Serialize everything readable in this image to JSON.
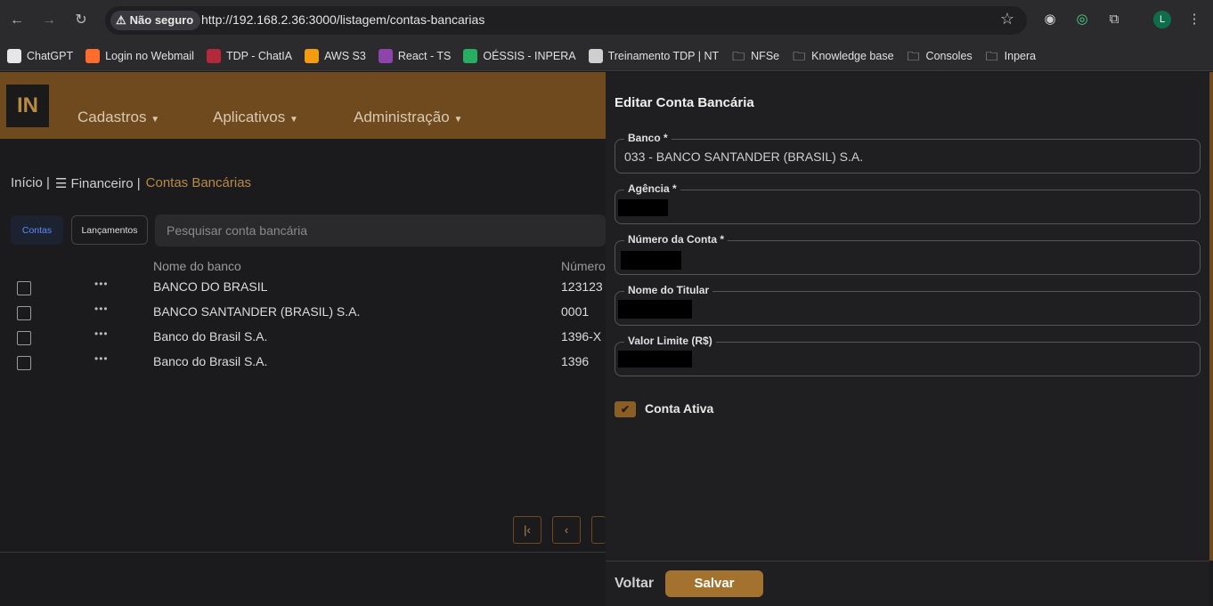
{
  "browser": {
    "security_label": "Não seguro",
    "url": "http://192.168.2.36:3000/listagem/contas-bancarias",
    "profile_initial": "L",
    "bookmarks": [
      {
        "label": "ChatGPT",
        "color": "#e6e6e6"
      },
      {
        "label": "Login no Webmail",
        "color": "#ff6c2c"
      },
      {
        "label": "TDP - ChatIA",
        "color": "#b3293a"
      },
      {
        "label": "AWS S3",
        "color": "#f39c12"
      },
      {
        "label": "React - TS",
        "color": "#8e44ad"
      },
      {
        "label": "OÉSSIS - INPERA",
        "color": "#27ae60"
      },
      {
        "label": "Treinamento TDP | NT",
        "color": "#cfcfcf"
      },
      {
        "label": "NFSe",
        "color": "folder"
      },
      {
        "label": "Knowledge base",
        "color": "folder"
      },
      {
        "label": "Consoles",
        "color": "folder"
      },
      {
        "label": "Inpera",
        "color": "folder"
      }
    ]
  },
  "app": {
    "logo_text": "IN",
    "menu": [
      "Cadastros",
      "Aplicativos",
      "Administração"
    ],
    "breadcrumb": {
      "home": "Início |",
      "section": "☰ Financeiro |",
      "current": "Contas Bancárias"
    },
    "tabs": {
      "active": "Contas",
      "other": "Lançamentos"
    },
    "search_placeholder": "Pesquisar conta bancária",
    "table": {
      "headers": {
        "bank": "Nome do banco",
        "number": "Número"
      },
      "rows": [
        {
          "bank": "BANCO DO BRASIL",
          "number": "123123"
        },
        {
          "bank": "BANCO SANTANDER (BRASIL) S.A.",
          "number": "0001"
        },
        {
          "bank": "Banco do Brasil S.A.",
          "number": "1396-X"
        },
        {
          "bank": "Banco do Brasil S.A.",
          "number": "1396"
        }
      ],
      "row_menu": "•••"
    },
    "pagination": {
      "first": "|‹",
      "prev": "‹"
    }
  },
  "drawer": {
    "title": "Editar Conta Bancária",
    "fields": {
      "banco": {
        "label": "Banco *",
        "value": "033 - BANCO SANTANDER (BRASIL) S.A."
      },
      "agencia": {
        "label": "Agência *"
      },
      "numero": {
        "label": "Número da Conta *"
      },
      "titular": {
        "label": "Nome do Titular"
      },
      "limite": {
        "label": "Valor Limite (R$)"
      }
    },
    "active_label": "Conta Ativa",
    "active_checked": true,
    "buttons": {
      "back": "Voltar",
      "save": "Salvar"
    }
  },
  "colors": {
    "accent": "#a4722f",
    "header": "#6f4a1e",
    "link": "#b98a44"
  }
}
